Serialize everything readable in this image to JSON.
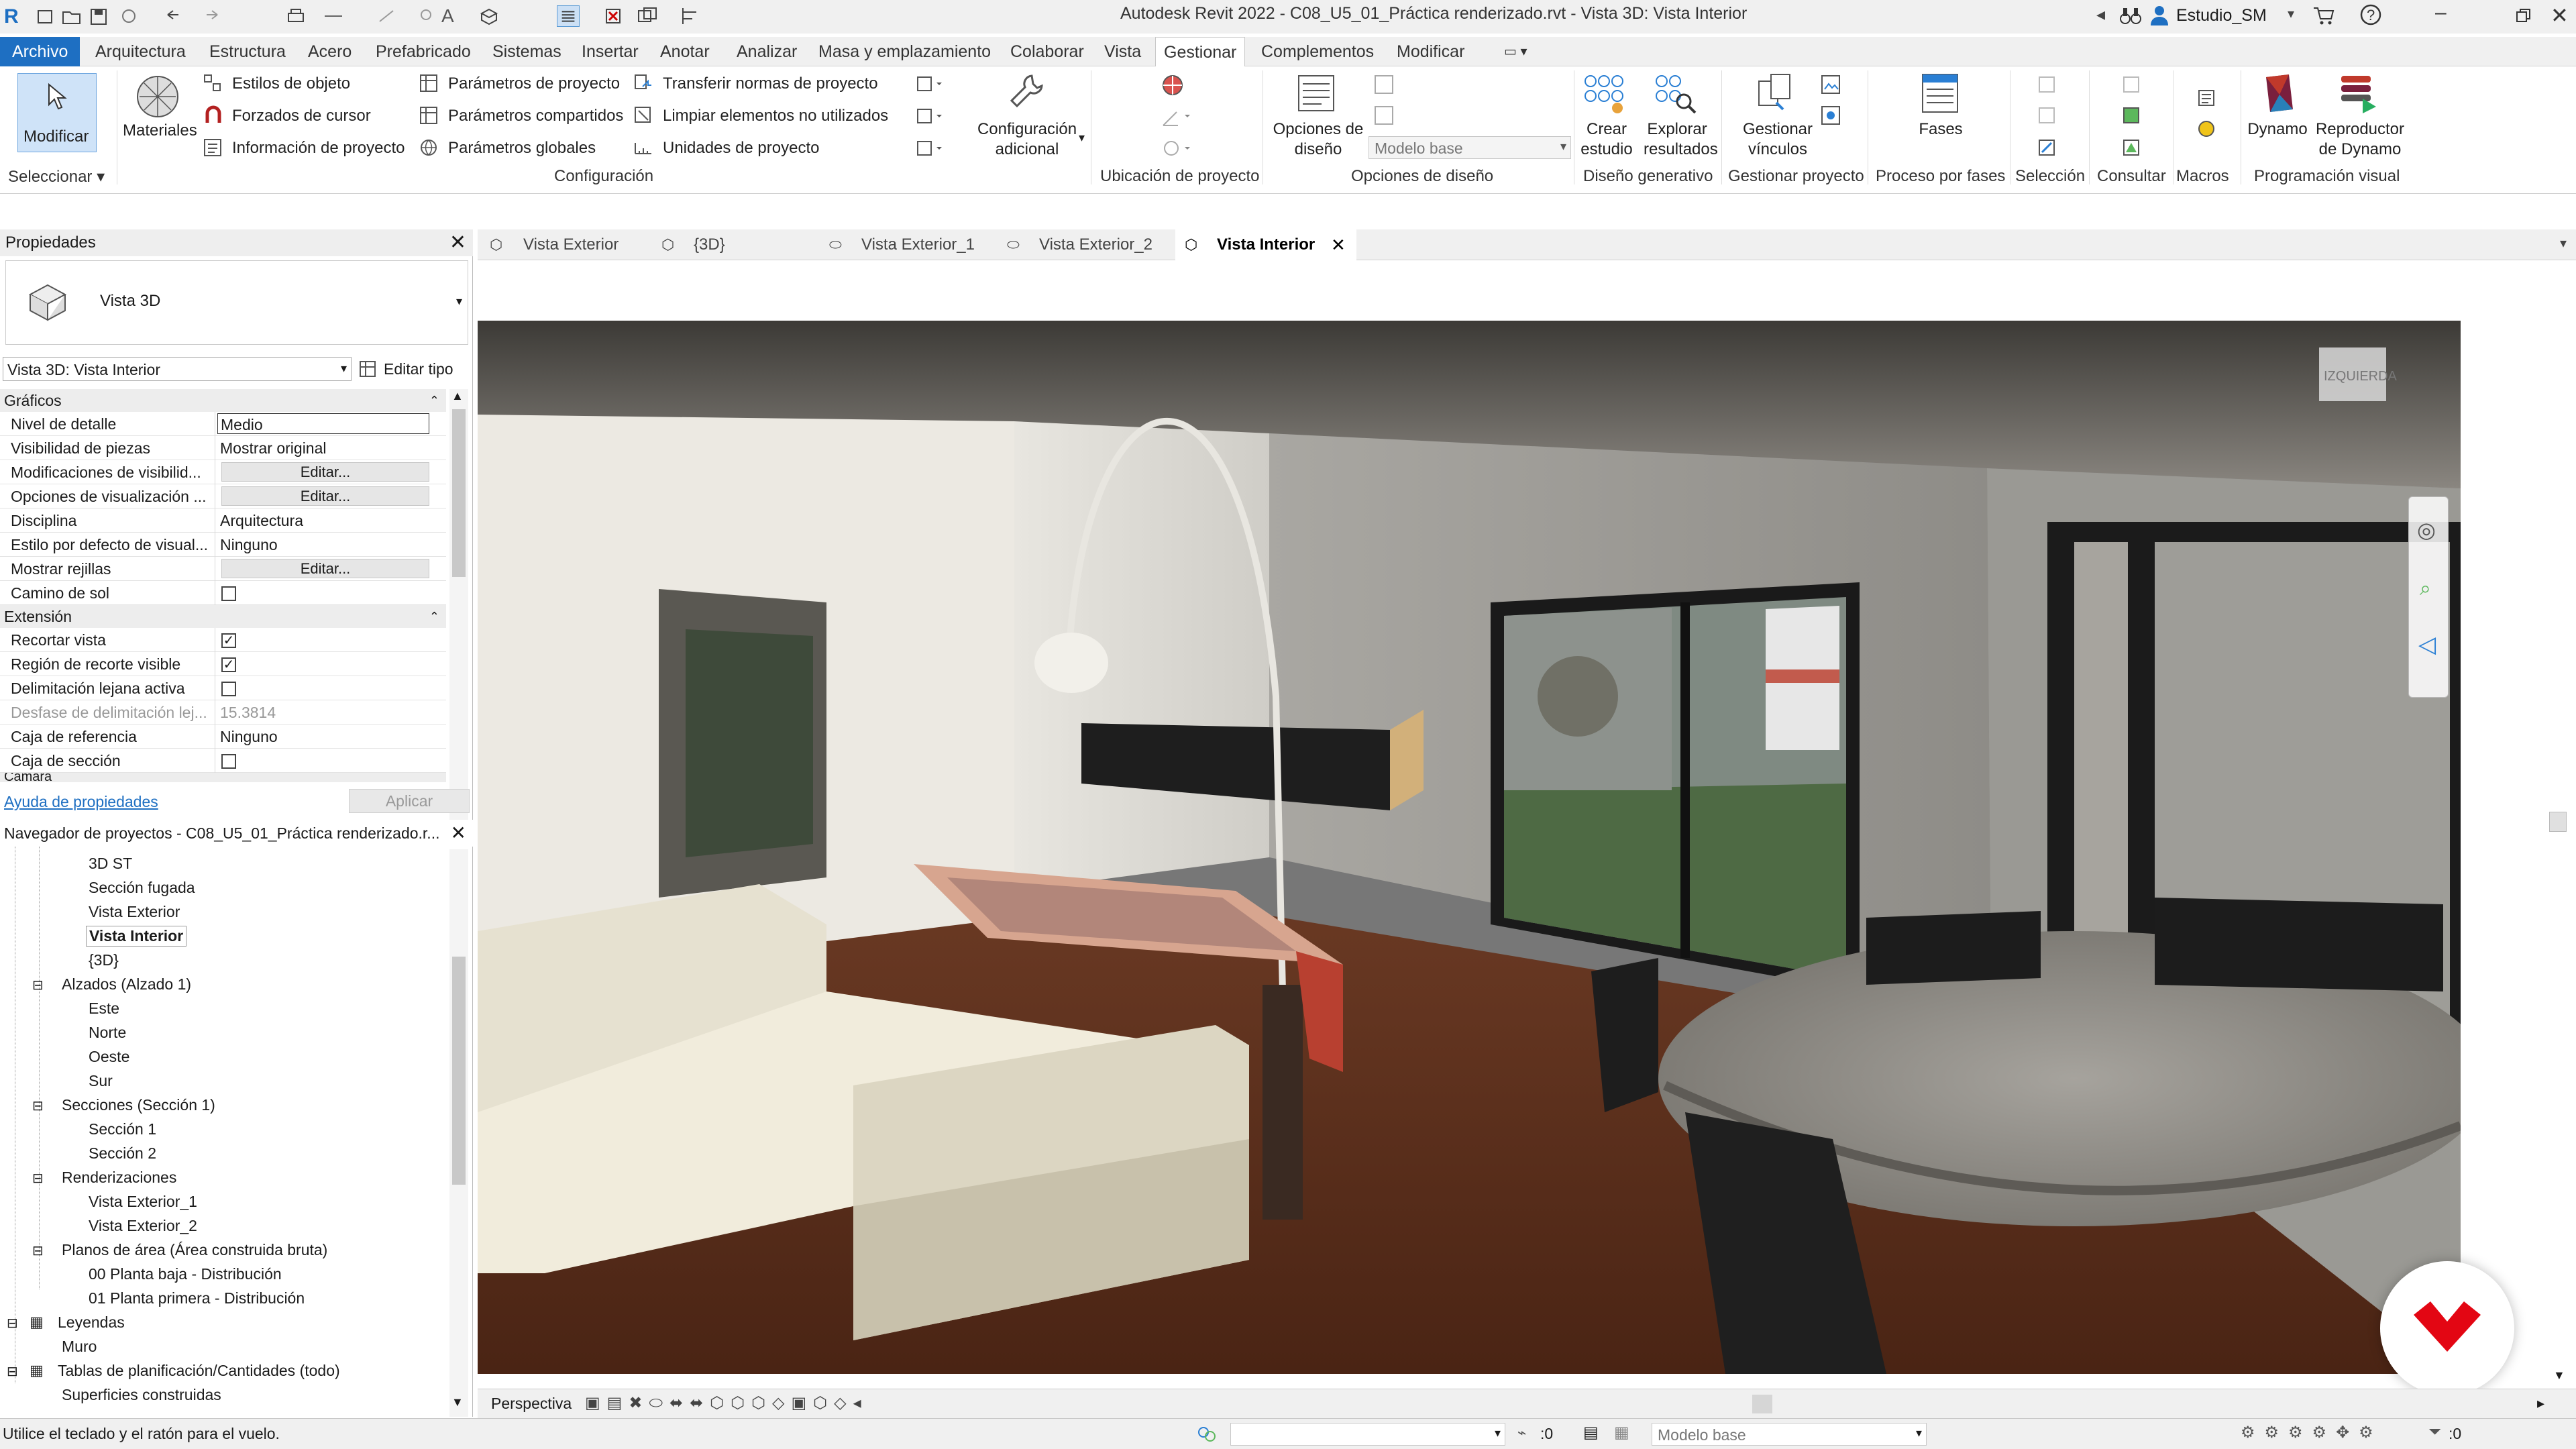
{
  "app": {
    "title": "Autodesk Revit 2022 - C08_U5_01_Práctica renderizado.rvt - Vista 3D: Vista Interior",
    "user": "Estudio_SM"
  },
  "menu_tabs": [
    "Archivo",
    "Arquitectura",
    "Estructura",
    "Acero",
    "Prefabricado",
    "Sistemas",
    "Insertar",
    "Anotar",
    "Analizar",
    "Masa y emplazamiento",
    "Colaborar",
    "Vista",
    "Gestionar",
    "Complementos",
    "Modificar"
  ],
  "ribbon": {
    "modificar": "Modificar",
    "seleccionar": "Seleccionar",
    "materiales": "Materiales",
    "estilos_objeto": "Estilos de objeto",
    "forzados_cursor": "Forzados de cursor",
    "info_proyecto": "Información de proyecto",
    "param_proyecto": "Parámetros de proyecto",
    "param_compartidos": "Parámetros compartidos",
    "param_globales": "Parámetros  globales",
    "transferir": "Transferir normas de proyecto",
    "limpiar": "Limpiar elementos no utilizados",
    "unidades": "Unidades de proyecto",
    "config_adicional_1": "Configuración",
    "config_adicional_2": "adicional",
    "configuracion_title": "Configuración",
    "ubicacion_title": "Ubicación de proyecto",
    "opciones_diseno_1": "Opciones de",
    "opciones_diseno_2": "diseño",
    "modelo_base": "Modelo base",
    "opciones_title": "Opciones de diseño",
    "crear_estudio_1": "Crear",
    "crear_estudio_2": "estudio",
    "explorar_1": "Explorar",
    "explorar_2": "resultados",
    "diseno_gen_title": "Diseño generativo",
    "gestionar_1": "Gestionar",
    "gestionar_2": "vínculos",
    "gestionar_title": "Gestionar proyecto",
    "fases": "Fases",
    "fases_title": "Proceso por fases",
    "seleccion_title": "Selección",
    "consultar_title": "Consultar",
    "macros_title": "Macros",
    "dynamo": "Dynamo",
    "reproductor_1": "Reproductor",
    "reproductor_2": "de Dynamo",
    "prog_visual_title": "Programación visual"
  },
  "properties": {
    "title": "Propiedades",
    "type_name": "Vista 3D",
    "selector": "Vista 3D: Vista Interior",
    "edit_type": "Editar tipo",
    "section_graficos": "Gráficos",
    "section_extension": "Extensión",
    "section_camara": "Cámara",
    "rows": [
      {
        "k": "Nivel de detalle",
        "v": "Medio"
      },
      {
        "k": "Visibilidad de piezas",
        "v": "Mostrar original"
      },
      {
        "k": "Modificaciones de visibilid...",
        "v": "Editar..."
      },
      {
        "k": "Opciones de visualización ...",
        "v": "Editar..."
      },
      {
        "k": "Disciplina",
        "v": "Arquitectura"
      },
      {
        "k": "Estilo por defecto de visual...",
        "v": "Ninguno"
      },
      {
        "k": "Mostrar rejillas",
        "v": "Editar..."
      },
      {
        "k": "Camino de sol",
        "v": ""
      },
      {
        "k": "Recortar vista",
        "v": "✓"
      },
      {
        "k": "Región de recorte visible",
        "v": "✓"
      },
      {
        "k": "Delimitación lejana activa",
        "v": ""
      },
      {
        "k": "Desfase de delimitación lej...",
        "v": "15.3814"
      },
      {
        "k": "Caja de referencia",
        "v": "Ninguno"
      },
      {
        "k": "Caja de sección",
        "v": ""
      }
    ],
    "help_link": "Ayuda de propiedades",
    "apply": "Aplicar"
  },
  "browser": {
    "title": "Navegador de proyectos - C08_U5_01_Práctica renderizado.r...",
    "items": [
      "3D ST",
      "Sección fugada",
      "Vista Exterior",
      "Vista Interior",
      "{3D}",
      "Alzados (Alzado 1)",
      "Este",
      "Norte",
      "Oeste",
      "Sur",
      "Secciones (Sección 1)",
      "Sección 1",
      "Sección 2",
      "Renderizaciones",
      "Vista Exterior_1",
      "Vista Exterior_2",
      "Planos de área (Área construida bruta)",
      "00 Planta baja - Distribución",
      "01 Planta primera - Distribución",
      "Leyendas",
      "Muro",
      "Tablas de planificación/Cantidades (todo)",
      "Superficies construidas"
    ]
  },
  "view_tabs": [
    "Vista Exterior",
    "{3D}",
    "Vista Exterior_1",
    "Vista Exterior_2",
    "Vista Interior"
  ],
  "viewcube_label": "IZQUIERDA",
  "viewbar": {
    "mode": "Perspectiva"
  },
  "status": {
    "message": "Utilice el teclado y el ratón para el vuelo.",
    "model": "Modelo base",
    "count": ":0"
  }
}
